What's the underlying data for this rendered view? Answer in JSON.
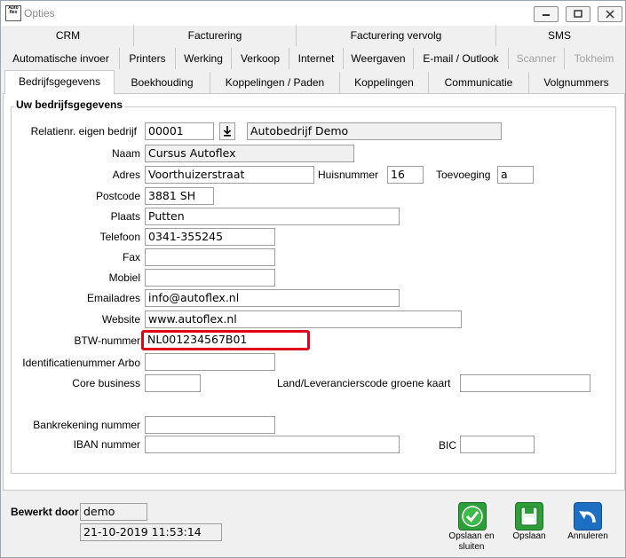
{
  "window": {
    "title": "Opties",
    "icon_text": "Auto flex"
  },
  "tabs_row1": [
    "CRM",
    "Facturering",
    "Facturering vervolg",
    "SMS"
  ],
  "tabs_row2": [
    "Automatische invoer",
    "Printers",
    "Werking",
    "Verkoop",
    "Internet",
    "Weergaven",
    "E-mail / Outlook",
    "Scanner",
    "Tokheim"
  ],
  "tabs_row3": [
    "Bedrijfsgegevens",
    "Boekhouding",
    "Koppelingen / Paden",
    "Koppelingen",
    "Communicatie",
    "Volgnummers"
  ],
  "group_title": "Uw bedrijfsgegevens",
  "form": {
    "relatienr_label": "Relatienr. eigen bedrijf",
    "relatienr_value": "00001",
    "relatie_name": "Autobedrijf Demo",
    "naam_label": "Naam",
    "naam_value": "Cursus Autoflex",
    "adres_label": "Adres",
    "adres_value": "Voorthuizerstraat",
    "huisnummer_label": "Huisnummer",
    "huisnummer_value": "16",
    "toevoeging_label": "Toevoeging",
    "toevoeging_value": "a",
    "postcode_label": "Postcode",
    "postcode_value": "3881 SH",
    "plaats_label": "Plaats",
    "plaats_value": "Putten",
    "telefoon_label": "Telefoon",
    "telefoon_value": "0341-355245",
    "fax_label": "Fax",
    "fax_value": "",
    "mobiel_label": "Mobiel",
    "mobiel_value": "",
    "email_label": "Emailadres",
    "email_value": "info@autoflex.nl",
    "website_label": "Website",
    "website_value": "www.autoflex.nl",
    "btw_label": "BTW-nummer",
    "btw_value": "NL001234567B01",
    "arbo_label": "Identificatienummer Arbo",
    "arbo_value": "",
    "core_label": "Core business",
    "core_value": "",
    "groene_kaart_label": "Land/Leverancierscode groene kaart",
    "groene_kaart_value": "",
    "bank_label": "Bankrekening nummer",
    "bank_value": "",
    "iban_label": "IBAN nummer",
    "iban_value": "",
    "bic_label": "BIC",
    "bic_value": ""
  },
  "footer": {
    "bewerkt_label": "Bewerkt door",
    "bewerkt_user": "demo",
    "bewerkt_date": "21-10-2019 11:53:14",
    "save_close_label_1": "Opslaan en",
    "save_close_label_2": "sluiten",
    "save_label": "Opslaan",
    "cancel_label": "Annuleren"
  },
  "colors": {
    "highlight": "#e0001b",
    "save_green": "#2e9e3a",
    "cancel_blue": "#1d6fc4"
  }
}
